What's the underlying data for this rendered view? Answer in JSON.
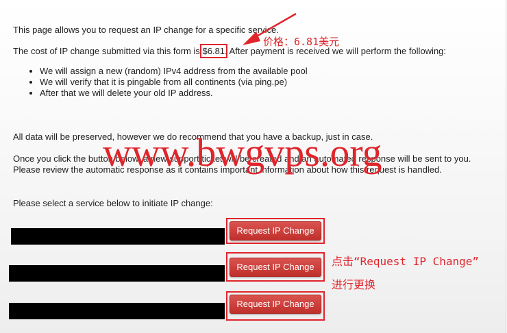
{
  "intro": {
    "line1": "This page allows you to request an IP change for a specific service.",
    "cost_prefix": "The cost of IP change submitted via this form is ",
    "cost_value": "$6.81",
    "cost_suffix": ". After payment is received we will perform the following:"
  },
  "steps": [
    "We will assign a new (random) IPv4 address from the available pool",
    "We will verify that it is pingable from all continents (via ping.pe)",
    "After that we will delete your old IP address."
  ],
  "notes": {
    "preserve": "All data will be preserved, however we do recommend that you have a backup, just in case.",
    "ticket": "Once you click the button below, a new support ticket will be created and an automated response will be sent to you. Please review the automatic response as it contains important information about how this request is handled.",
    "select": "Please select a service below to initiate IP change:"
  },
  "services": [
    {
      "button_label": "Request IP Change"
    },
    {
      "button_label": "Request IP Change"
    },
    {
      "button_label": "Request IP Change"
    }
  ],
  "annotations": {
    "price_note": "价格：6.81美元",
    "click_note_line1": "点击“Request IP Change”",
    "click_note_line2": "进行更换",
    "watermark": "www.bwgvps.org"
  },
  "colors": {
    "annotation_red": "#e0242b",
    "button_red": "#d9534f"
  }
}
